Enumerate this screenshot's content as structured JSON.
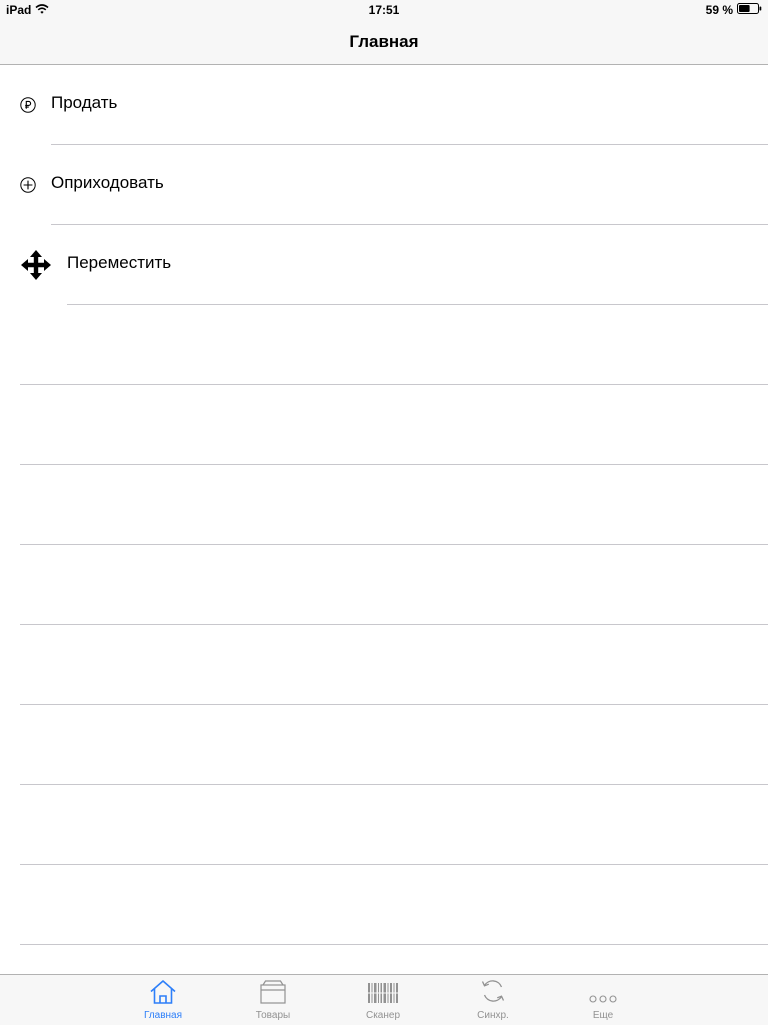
{
  "status": {
    "carrier": "iPad",
    "time": "17:51",
    "battery": "59 %",
    "battery_level": 0.59
  },
  "nav": {
    "title": "Главная"
  },
  "menu": [
    {
      "label": "Продать",
      "icon": "ruble-circle-icon"
    },
    {
      "label": "Оприходовать",
      "icon": "plus-circle-icon"
    },
    {
      "label": "Переместить",
      "icon": "move-arrows-icon"
    }
  ],
  "tabs": [
    {
      "label": "Главная",
      "icon": "home-icon",
      "active": true
    },
    {
      "label": "Товары",
      "icon": "box-icon",
      "active": false
    },
    {
      "label": "Сканер",
      "icon": "barcode-icon",
      "active": false
    },
    {
      "label": "Синхр.",
      "icon": "sync-icon",
      "active": false
    },
    {
      "label": "Еще",
      "icon": "more-icon",
      "active": false
    }
  ],
  "colors": {
    "accent": "#2d7ff9",
    "inactive": "#929292",
    "separator": "#c8c7cc",
    "bar_background": "#f7f7f7"
  }
}
